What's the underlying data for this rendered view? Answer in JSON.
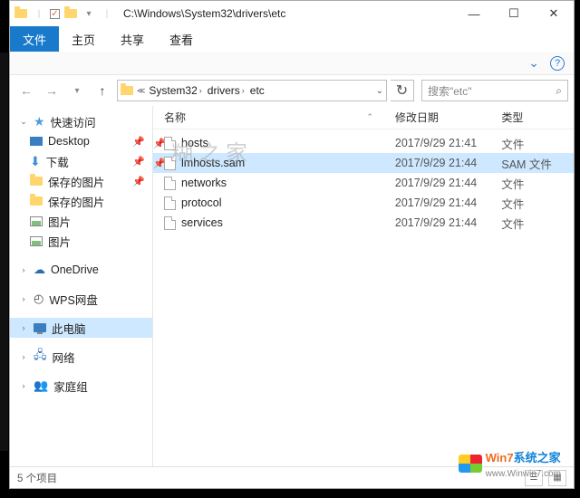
{
  "title_path": "C:\\Windows\\System32\\drivers\\etc",
  "ribbon": {
    "file": "文件",
    "home": "主页",
    "share": "共享",
    "view": "查看"
  },
  "breadcrumbs": [
    "System32",
    "drivers",
    "etc"
  ],
  "search_placeholder": "搜索\"etc\"",
  "columns": {
    "name": "名称",
    "date": "修改日期",
    "type": "类型"
  },
  "sidebar": {
    "quick": "快速访问",
    "desktop": "Desktop",
    "downloads": "下载",
    "saved_pics1": "保存的图片",
    "saved_pics2": "保存的图片",
    "pics1": "图片",
    "pics2": "图片",
    "onedrive": "OneDrive",
    "wps": "WPS网盘",
    "thispc": "此电脑",
    "network": "网络",
    "homegroup": "家庭组"
  },
  "files": [
    {
      "name": "hosts",
      "date": "2017/9/29 21:41",
      "type": "文件",
      "selected": false,
      "pin": true
    },
    {
      "name": "lmhosts.sam",
      "date": "2017/9/29 21:44",
      "type": "SAM 文件",
      "selected": true,
      "pin": true
    },
    {
      "name": "networks",
      "date": "2017/9/29 21:44",
      "type": "文件",
      "selected": false,
      "pin": false
    },
    {
      "name": "protocol",
      "date": "2017/9/29 21:44",
      "type": "文件",
      "selected": false,
      "pin": false
    },
    {
      "name": "services",
      "date": "2017/9/29 21:44",
      "type": "文件",
      "selected": false,
      "pin": false
    }
  ],
  "status": "5 个项目",
  "watermark": "糊之家",
  "wm_brand1": "Win7",
  "wm_brand2": "系统之家",
  "wm_url": "www.Winwin7.com"
}
